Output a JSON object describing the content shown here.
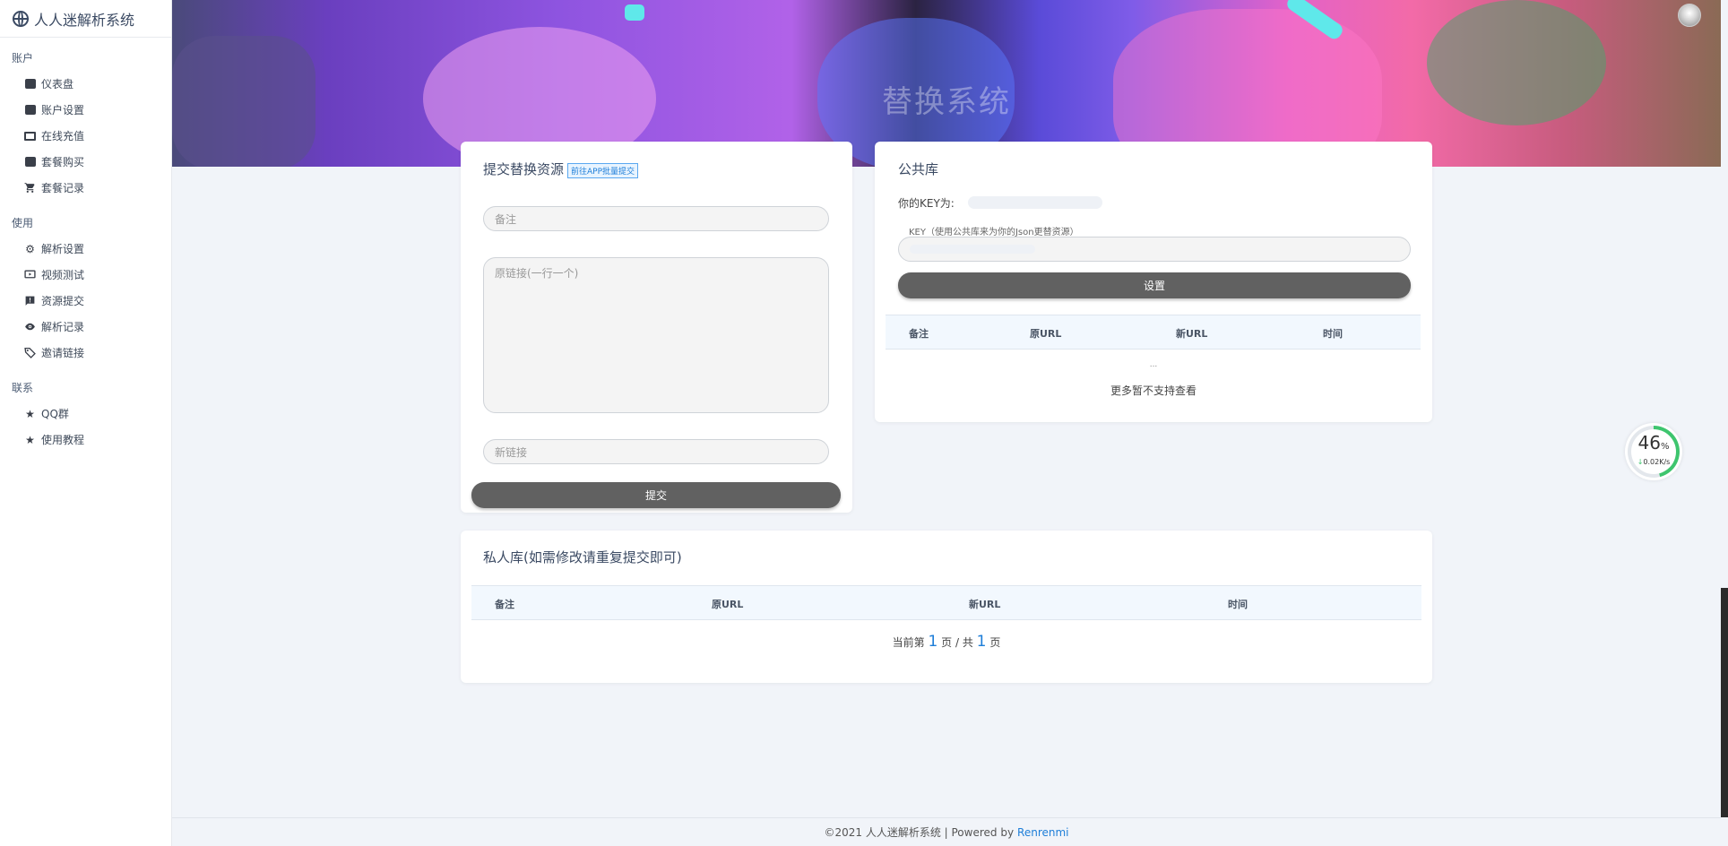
{
  "brand": {
    "title": "人人迷解析系统"
  },
  "sidebar": {
    "sections": [
      {
        "label": "账户",
        "items": [
          {
            "label": "仪表盘",
            "icon": "wallet-icon"
          },
          {
            "label": "账户设置",
            "icon": "account-box-icon"
          },
          {
            "label": "在线充值",
            "icon": "credit-card-icon"
          },
          {
            "label": "套餐购买",
            "icon": "shopping-bag-icon"
          },
          {
            "label": "套餐记录",
            "icon": "cart-icon"
          }
        ]
      },
      {
        "label": "使用",
        "items": [
          {
            "label": "解析设置",
            "icon": "gear-icon"
          },
          {
            "label": "视频测试",
            "icon": "video-icon"
          },
          {
            "label": "资源提交",
            "icon": "alert-box-icon"
          },
          {
            "label": "解析记录",
            "icon": "eye-icon"
          },
          {
            "label": "邀请链接",
            "icon": "tag-icon"
          }
        ]
      },
      {
        "label": "联系",
        "items": [
          {
            "label": "QQ群",
            "icon": "star-icon"
          },
          {
            "label": "使用教程",
            "icon": "star-icon"
          }
        ]
      }
    ]
  },
  "banner": {
    "title": "替换系统"
  },
  "submit_card": {
    "title": "提交替换资源",
    "badge": "前往APP批量提交",
    "note_placeholder": "备注",
    "origin_placeholder": "原链接(一行一个)",
    "new_placeholder": "新链接",
    "submit_label": "提交"
  },
  "public_card": {
    "title": "公共库",
    "key_label": "你的KEY为:",
    "key_field_label": "KEY（使用公共库来为你的Json更替资源）",
    "set_label": "设置",
    "columns": [
      "备注",
      "原URL",
      "新URL",
      "时间"
    ],
    "ellipsis": "...",
    "empty_text": "更多暂不支持查看"
  },
  "private_card": {
    "title": "私人库(如需修改请重复提交即可)",
    "columns": [
      "备注",
      "原URL",
      "新URL",
      "时间"
    ],
    "pager_prefix": "当前第",
    "current_page": "1",
    "pager_mid": "页 / 共",
    "total_pages": "1",
    "pager_suffix": "页"
  },
  "speed_widget": {
    "percent": "46",
    "percent_unit": "%",
    "rate": "0.02K/s",
    "rate_arrow": "↓"
  },
  "footer": {
    "text": "©2021 人人迷解析系统 | Powered by",
    "link": "Renrenmi"
  },
  "colors": {
    "accent": "#1e7ed8",
    "button": "#616161",
    "ring": "#3ec56e"
  }
}
